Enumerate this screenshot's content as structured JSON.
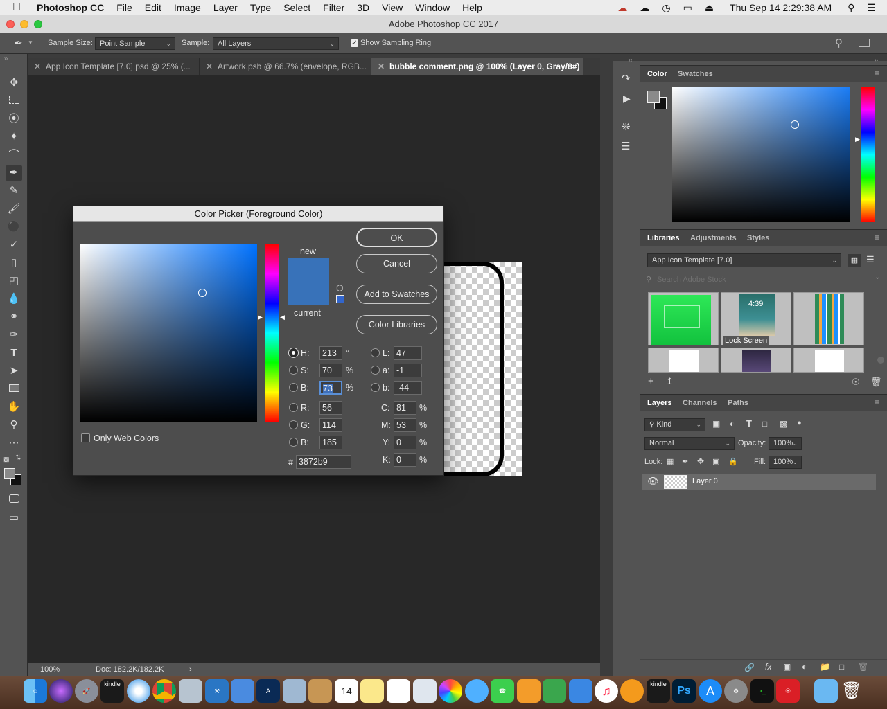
{
  "menubar": {
    "apple_icon": "apple-icon",
    "app_name": "Photoshop CC",
    "items": [
      "File",
      "Edit",
      "Image",
      "Layer",
      "Type",
      "Select",
      "Filter",
      "3D",
      "View",
      "Window",
      "Help"
    ],
    "clock": "Thu Sep 14  2:29:38 AM"
  },
  "window": {
    "title": "Adobe Photoshop CC 2017"
  },
  "options": {
    "sample_size_label": "Sample Size:",
    "sample_size_value": "Point Sample",
    "sample_label": "Sample:",
    "sample_value": "All Layers",
    "show_ring_label": "Show Sampling Ring",
    "show_ring_checked": true
  },
  "tabs": [
    {
      "label": "App Icon Template [7.0].psd @ 25% (..."
    },
    {
      "label": "Artwork.psb @ 66.7% (envelope, RGB..."
    },
    {
      "label": "bubble comment.png @ 100% (Layer 0, Gray/8#)"
    }
  ],
  "status": {
    "zoom": "100%",
    "doc": "Doc: 182.2K/182.2K",
    "arrow": "›"
  },
  "color_panel": {
    "tabs": [
      "Color",
      "Swatches"
    ],
    "colors": {
      "spectrum_top": "#3872b9",
      "fg": "#8a8a8a",
      "bg": "#111111"
    }
  },
  "libraries_panel": {
    "tabs": [
      "Libraries",
      "Adjustments",
      "Styles"
    ],
    "library_select": "App Icon Template [7.0]",
    "search_placeholder": "Search Adobe Stock",
    "tiles": [
      {
        "label": "",
        "color": "#1fd04a"
      },
      {
        "label": "Lock Screen",
        "color": "#1d6f83",
        "time": "4:39"
      },
      {
        "label": "",
        "color": "#2b7fd0"
      }
    ]
  },
  "layers_panel": {
    "tabs": [
      "Layers",
      "Channels",
      "Paths"
    ],
    "kind_label": "Kind",
    "blend_mode": "Normal",
    "opacity_label": "Opacity:",
    "opacity_value": "100%",
    "lock_label": "Lock:",
    "fill_label": "Fill:",
    "fill_value": "100%",
    "layers": [
      {
        "name": "Layer 0",
        "visible": true
      }
    ]
  },
  "color_picker": {
    "title": "Color Picker (Foreground Color)",
    "buttons": {
      "ok": "OK",
      "cancel": "Cancel",
      "add_swatches": "Add to Swatches",
      "color_libraries": "Color Libraries"
    },
    "new_label": "new",
    "current_label": "current",
    "new_color": "#3872b9",
    "current_color": "#3872b9",
    "only_web_colors": "Only Web Colors",
    "hsb": {
      "h_label": "H:",
      "h_value": "213",
      "h_unit": "°",
      "s_label": "S:",
      "s_value": "70",
      "s_unit": "%",
      "b_label": "B:",
      "b_value": "73",
      "b_unit": "%"
    },
    "rgb": {
      "r_label": "R:",
      "r_value": "56",
      "g_label": "G:",
      "g_value": "114",
      "b_label": "B:",
      "b_value": "185"
    },
    "lab": {
      "l_label": "L:",
      "l_value": "47",
      "a_label": "a:",
      "a_value": "-1",
      "b_label": "b:",
      "b_value": "-44"
    },
    "cmyk": {
      "c_label": "C:",
      "c_value": "81",
      "m_label": "M:",
      "m_value": "53",
      "y_label": "Y:",
      "y_value": "0",
      "k_label": "K:",
      "k_value": "0",
      "unit": "%"
    },
    "hex_label": "#",
    "hex_value": "3872b9",
    "selected_channel": "B"
  },
  "dock": {
    "items": [
      "finder",
      "siri",
      "launchpad",
      "kindle",
      "safari",
      "chrome",
      "preview",
      "xcode",
      "sketch",
      "artboard",
      "mail-bird",
      "contacts",
      "calendar",
      "notes",
      "reminders",
      "photos-viewer",
      "photos",
      "messages",
      "facetime",
      "pages",
      "numbers",
      "keynote",
      "itunes",
      "ibooks",
      "kindle",
      "photoshop",
      "app-store",
      "system-preferences",
      "terminal",
      "creative-cloud",
      "downloads",
      "trash"
    ],
    "calendar_day": "14",
    "kindle_label": "kindle",
    "ps_label": "Ps"
  }
}
